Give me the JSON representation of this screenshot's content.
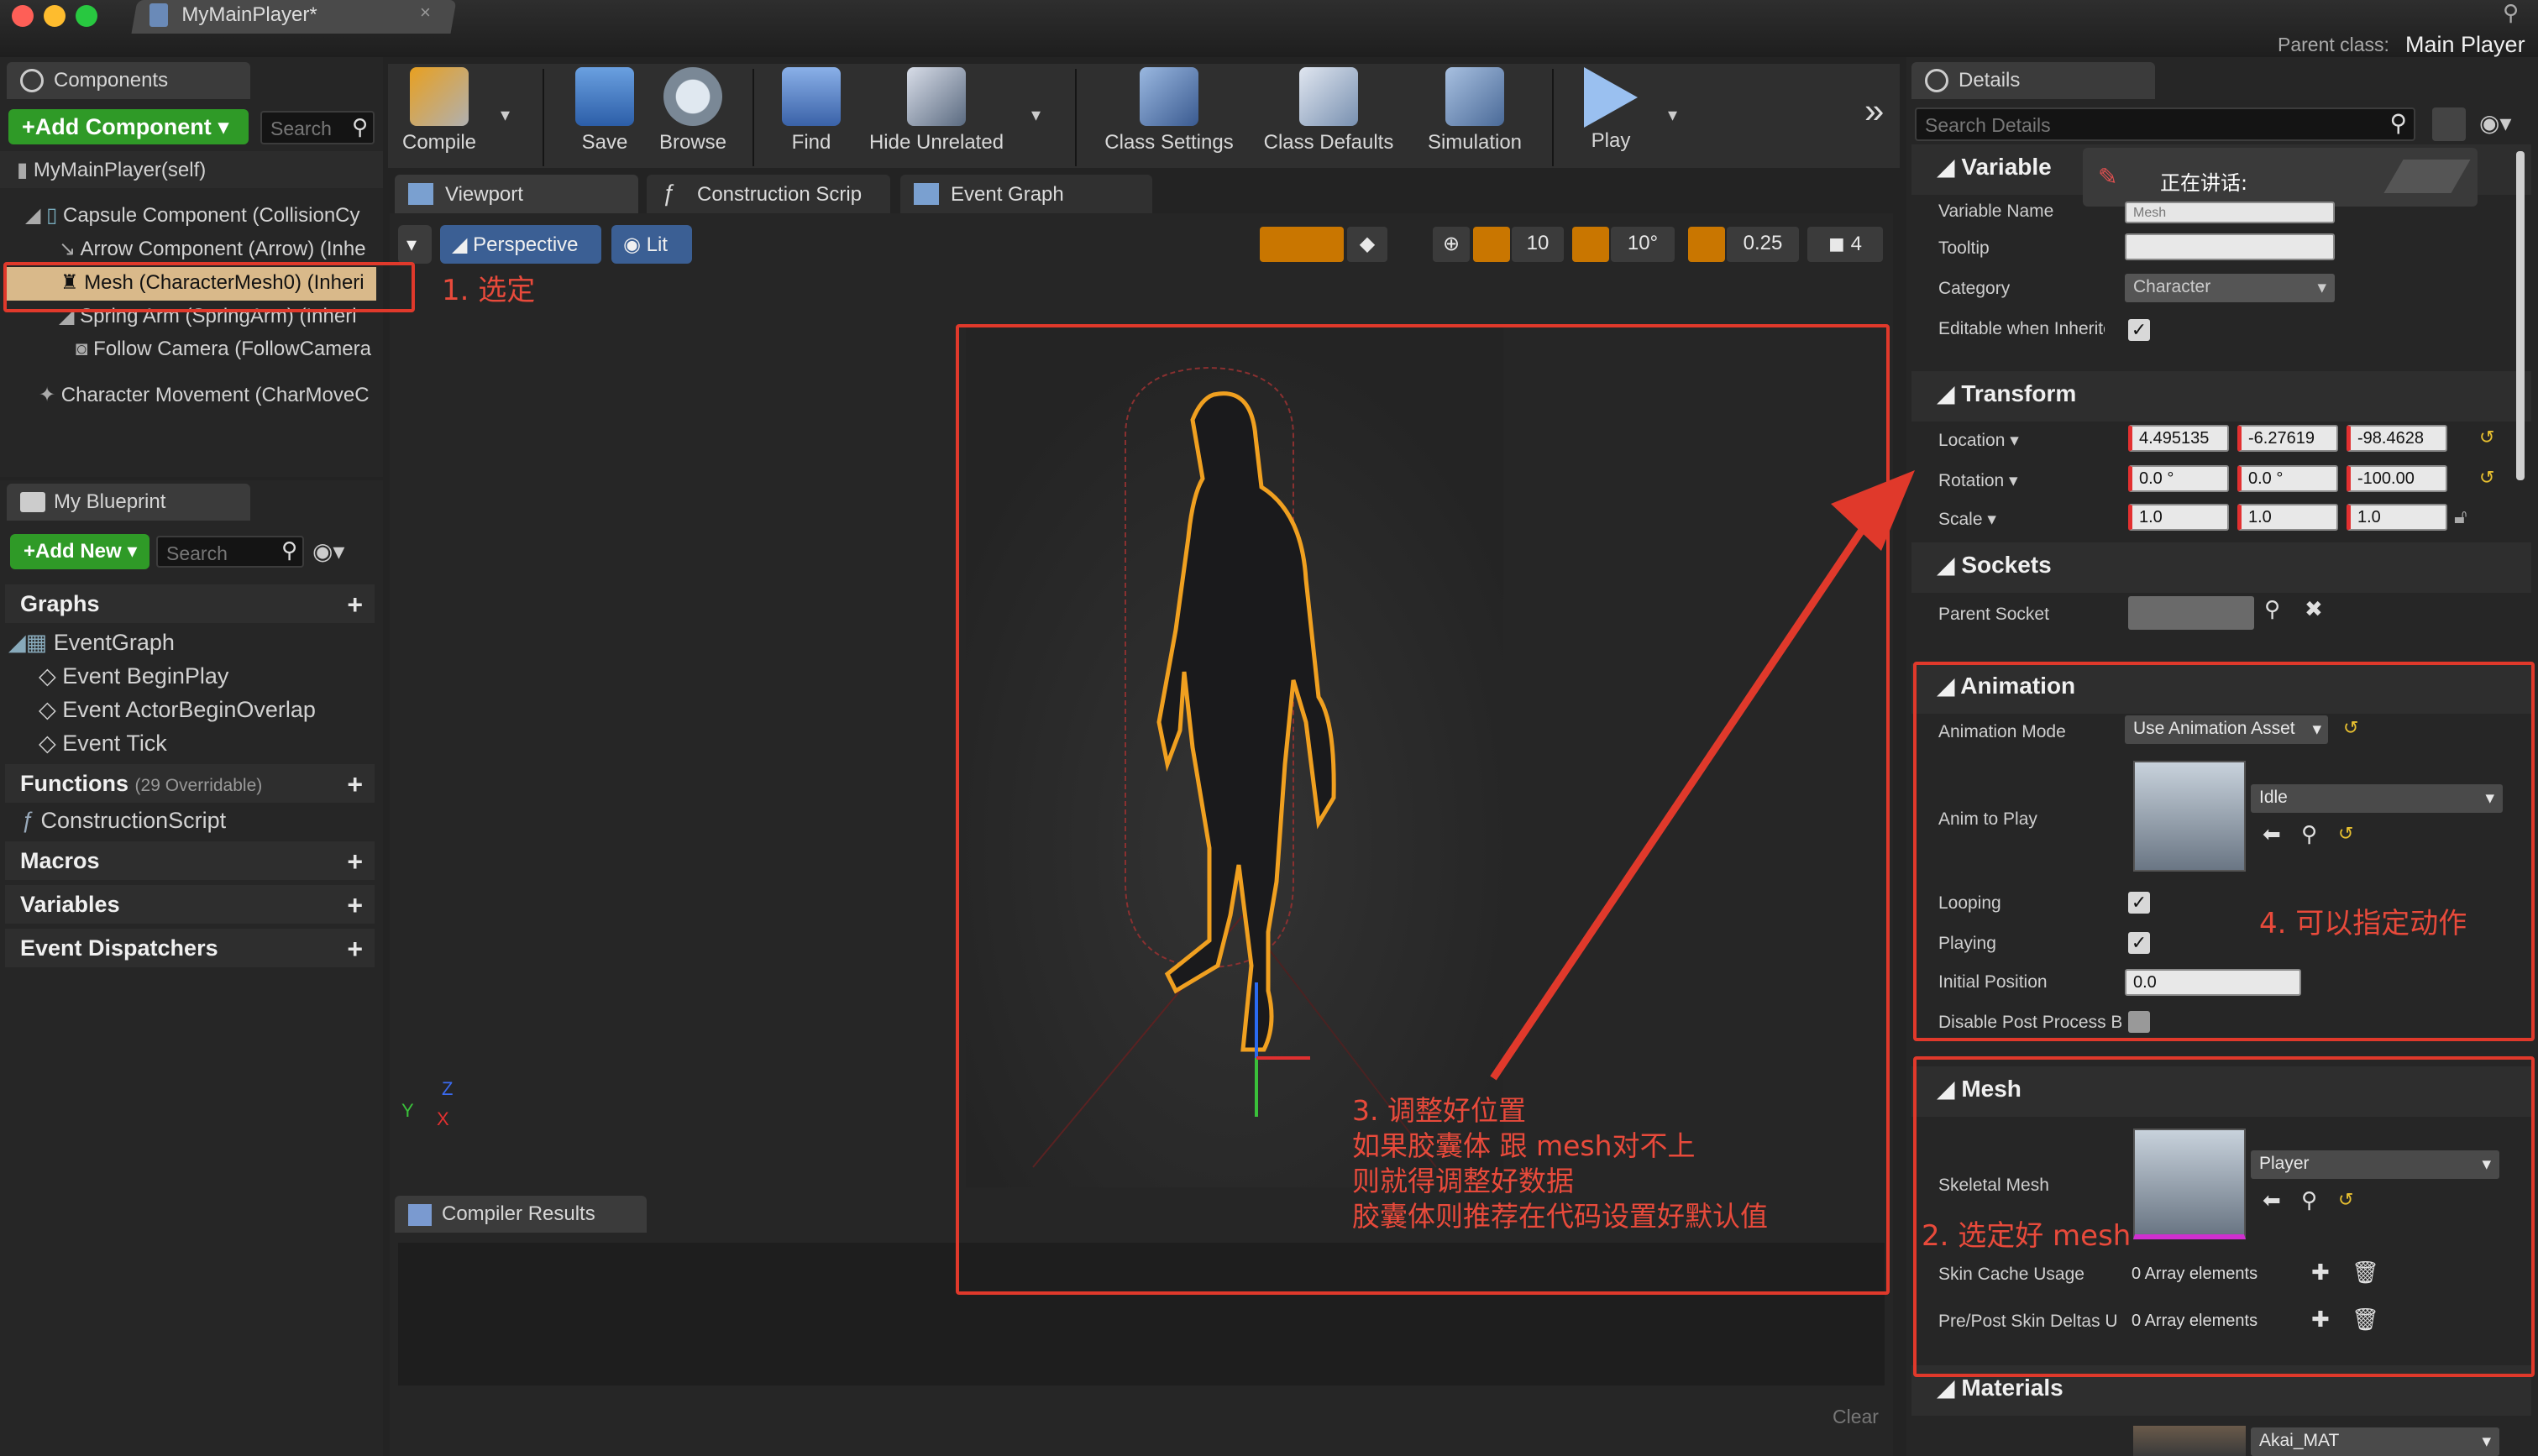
{
  "window": {
    "title": "MyMainPlayer*",
    "parent_class_label": "Parent class:",
    "parent_class_value": "Main Player"
  },
  "components": {
    "tab": "Components",
    "add_button": "+Add Component",
    "search_placeholder": "Search",
    "items": [
      "MyMainPlayer(self)",
      "Capsule Component (CollisionCy",
      "Arrow Component (Arrow) (Inhe",
      "Mesh (CharacterMesh0) (Inheri",
      "Spring Arm (SpringArm) (Inheri",
      "Follow Camera (FollowCamera",
      "Character Movement (CharMoveC"
    ]
  },
  "blueprint": {
    "tab": "My Blueprint",
    "add_button": "+Add New",
    "search_placeholder": "Search",
    "graphs": "Graphs",
    "event_graph": "EventGraph",
    "events": [
      "Event BeginPlay",
      "Event ActorBeginOverlap",
      "Event Tick"
    ],
    "functions": "Functions",
    "functions_count": "(29 Overridable)",
    "construction_script": "ConstructionScript",
    "macros": "Macros",
    "variables": "Variables",
    "dispatchers": "Event Dispatchers"
  },
  "toolbar": {
    "buttons": [
      "Compile",
      "Save",
      "Browse",
      "Find",
      "Hide Unrelated",
      "Class Settings",
      "Class Defaults",
      "Simulation",
      "Play"
    ],
    "more": "»"
  },
  "viewport_tabs": [
    "Viewport",
    "Construction Scrip",
    "Event Graph"
  ],
  "viewport": {
    "perspective": "Perspective",
    "lit": "Lit",
    "grid_snap": "10",
    "rot_snap": "10°",
    "scale_snap": "0.25",
    "cam_speed": "4",
    "axis_z": "Z",
    "axis_y": "Y",
    "axis_x": "X"
  },
  "compiler": {
    "tab": "Compiler Results",
    "clear": "Clear"
  },
  "details": {
    "tab": "Details",
    "search_placeholder": "Search Details",
    "overlay_text": "正在讲话:",
    "variable": {
      "head": "Variable",
      "name_label": "Variable Name",
      "name_value": "Mesh",
      "tooltip_label": "Tooltip",
      "category_label": "Category",
      "category_value": "Character",
      "editable_label": "Editable when Inheritec"
    },
    "transform": {
      "head": "Transform",
      "location": "Location",
      "rotation": "Rotation",
      "scale": "Scale",
      "loc_vals": [
        "4.495135",
        "-6.27619",
        "-98.4628"
      ],
      "rot_vals": [
        "0.0 °",
        "0.0 °",
        "-100.00"
      ],
      "scale_vals": [
        "1.0",
        "1.0",
        "1.0"
      ]
    },
    "sockets": {
      "head": "Sockets",
      "parent_socket": "Parent Socket"
    },
    "animation": {
      "head": "Animation",
      "mode_label": "Animation Mode",
      "mode_value": "Use Animation Asset",
      "anim_label": "Anim to Play",
      "anim_value": "Idle",
      "looping": "Looping",
      "playing": "Playing",
      "initial_pos": "Initial Position",
      "initial_val": "0.0",
      "disable_post": "Disable Post Process B"
    },
    "mesh": {
      "head": "Mesh",
      "skeletal_label": "Skeletal Mesh",
      "skeletal_value": "Player",
      "skin_cache": "Skin Cache Usage",
      "skin_cache_val": "0 Array elements",
      "prepost": "Pre/Post Skin Deltas U",
      "prepost_val": "0 Array elements"
    },
    "materials": {
      "head": "Materials",
      "mat_value": "Akai_MAT"
    }
  },
  "annotations": {
    "a1": "1. 选定",
    "a2": "2. 选定好 mesh",
    "a3_lines": [
      "3. 调整好位置",
      "如果胶囊体 跟 mesh对不上",
      "则就得调整好数据",
      "胶囊体则推荐在代码设置好默认值"
    ],
    "a4": "4. 可以指定动作"
  },
  "colors": {
    "accent_green": "#2f9a27",
    "annotation_red": "#e0392b",
    "selection_orange": "#f0a020",
    "snap_orange": "#c97600"
  }
}
